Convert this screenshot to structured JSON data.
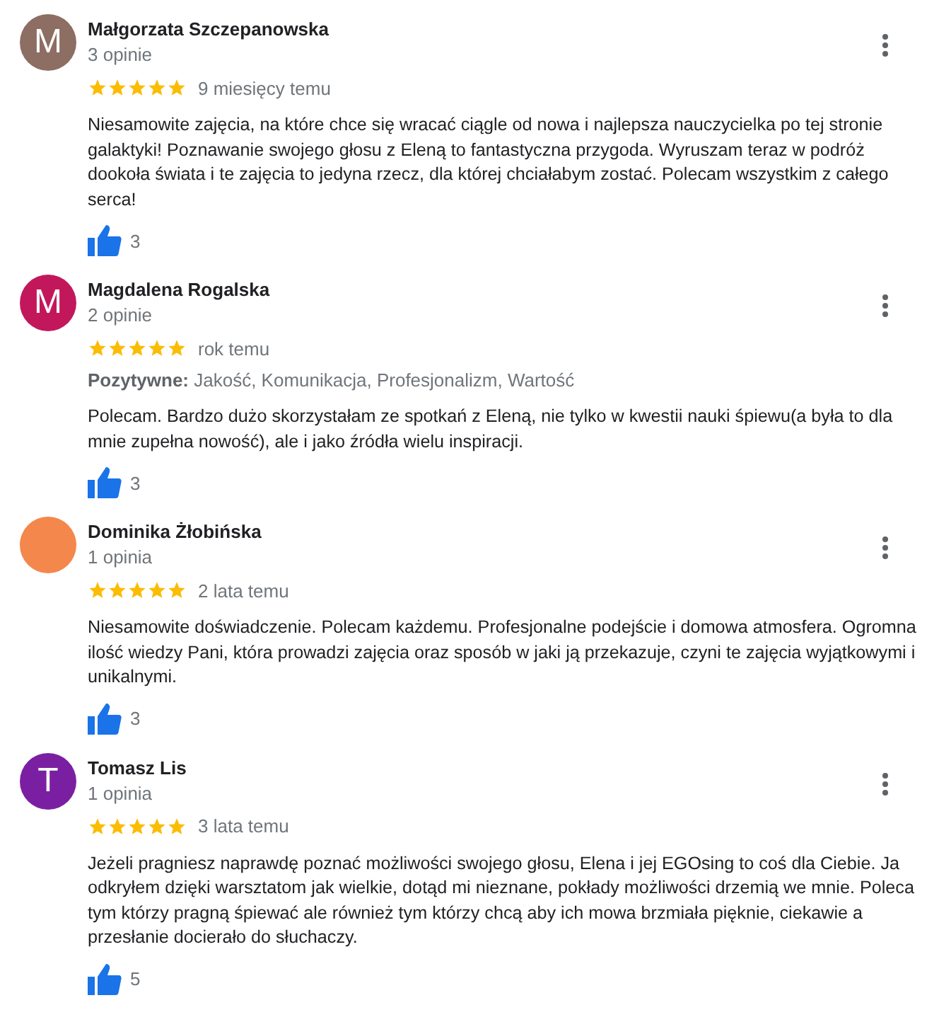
{
  "reviews": [
    {
      "author": "Małgorzata Szczepanowska",
      "avatar": {
        "letter": "M",
        "color": "#8d6e63"
      },
      "review_count": "3 opinie",
      "stars": 5,
      "time": "9 miesięcy temu",
      "text": "Niesamowite zajęcia, na które chce się wracać ciągle od nowa i najlepsza nauczycielka po tej stronie galaktyki! Poznawanie swojego głosu z Eleną to fantastyczna przygoda. Wyruszam teraz w podróż dookoła świata i te zajęcia to jedyna rzecz, dla której chciałabym zostać. Polecam wszystkim z całego serca!",
      "likes": "3"
    },
    {
      "author": "Magdalena Rogalska",
      "avatar": {
        "letter": "M",
        "color": "#c2185b"
      },
      "review_count": "2 opinie",
      "stars": 5,
      "time": "rok temu",
      "highlights": "**Pozytywne:** Jakość, Komunikacja, Profesjonalizm, Wartość",
      "text": "Polecam. Bardzo dużo skorzystałam ze spotkań z Eleną, nie tylko w kwestii nauki śpiewu(a była to dla mnie zupełna nowość), ale i jako źródła wielu inspiracji.",
      "likes": "3"
    },
    {
      "author": "Dominika Żłobińska",
      "avatar": {
        "color": "#f4874b"
      },
      "review_count": "1 opinia",
      "stars": 5,
      "time": "2 lata temu",
      "text": "Niesamowite doświadczenie. Polecam każdemu. Profesjonalne podejście i domowa atmosfera. Ogromna ilość wiedzy Pani, która prowadzi zajęcia oraz sposób w jaki ją przekazuje, czyni te zajęcia wyjątkowymi i unikalnymi.",
      "likes": "3"
    },
    {
      "author": "Tomasz Lis",
      "avatar": {
        "letter": "T",
        "color": "#7b1fa2"
      },
      "review_count": "1 opinia",
      "stars": 5,
      "time": "3 lata temu",
      "text": "Jeżeli pragniesz naprawdę poznać możliwości swojego głosu, Elena i jej EGOsing to coś dla Ciebie. Ja odkryłem dzięki warsztatom jak wielkie, dotąd mi nieznane, pokłady możliwości drzemią we mnie. Poleca tym którzy pragną śpiewać ale również tym którzy chcą aby ich mowa brzmiała pięknie, ciekawie a przesłanie docierało do słuchaczy.",
      "likes": "5"
    }
  ]
}
